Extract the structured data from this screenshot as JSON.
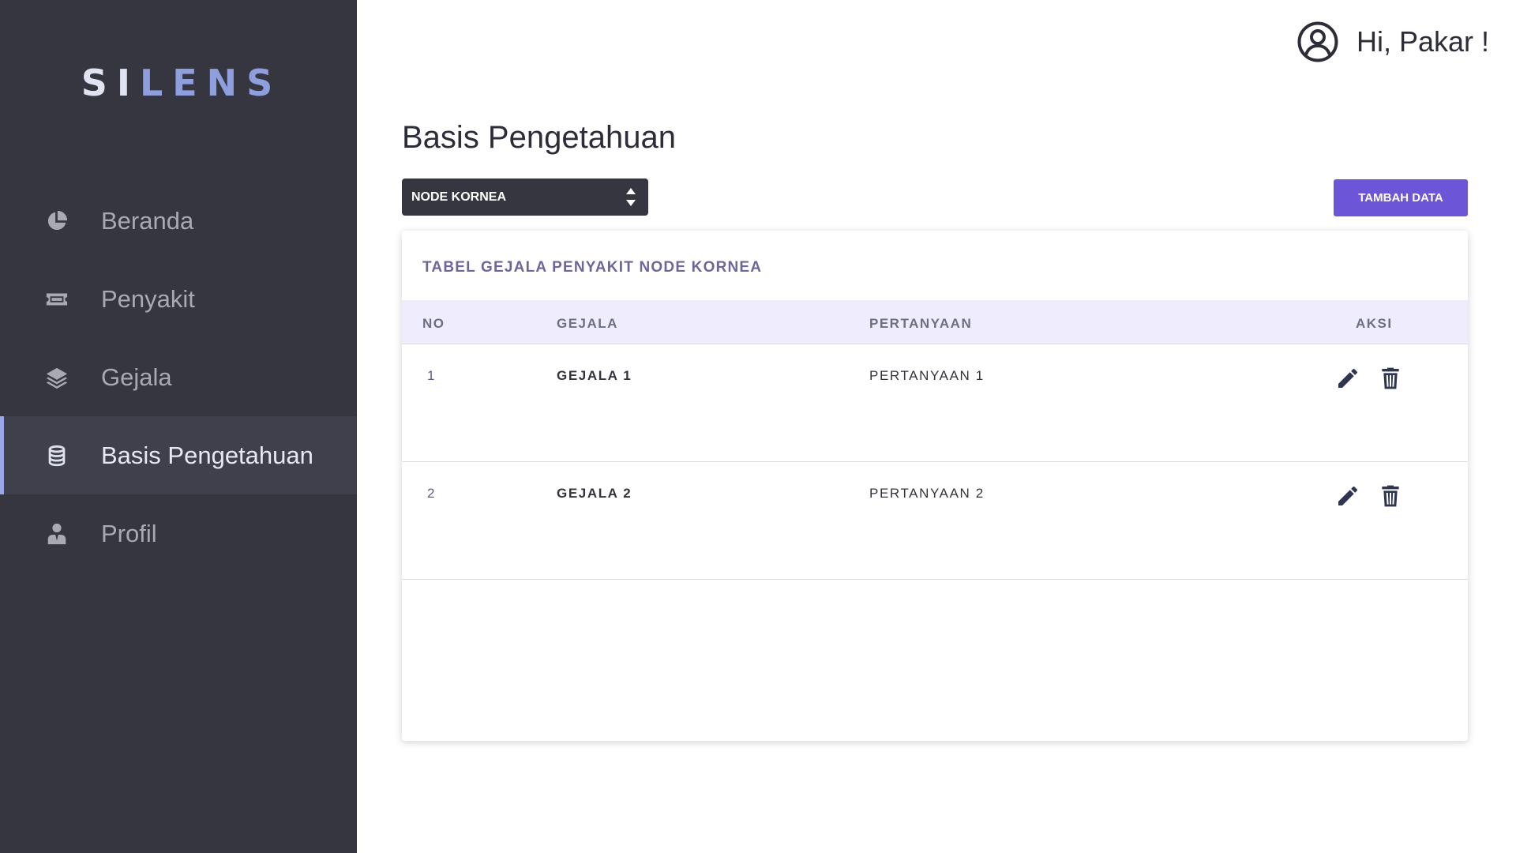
{
  "app": {
    "logo_part1": "SI",
    "logo_part2": "LENS"
  },
  "colors": {
    "sidebar_bg": "#363640",
    "accent": "#6c55d6",
    "logo_light": "#dfe3f2",
    "logo_blue": "#8f9fde"
  },
  "sidebar": {
    "items": [
      {
        "label": "Beranda",
        "icon": "pie-chart-icon",
        "active": false
      },
      {
        "label": "Penyakit",
        "icon": "ticket-icon",
        "active": false
      },
      {
        "label": "Gejala",
        "icon": "layers-icon",
        "active": false
      },
      {
        "label": "Basis Pengetahuan",
        "icon": "database-icon",
        "active": true
      },
      {
        "label": "Profil",
        "icon": "user-tie-icon",
        "active": false
      }
    ]
  },
  "header": {
    "greeting": "Hi, Pakar !",
    "user_icon": "user-circle-icon"
  },
  "main": {
    "title": "Basis Pengetahuan",
    "select": {
      "selected": "NODE KORNEA"
    },
    "add_button_label": "TAMBAH DATA",
    "table": {
      "title": "TABEL GEJALA PENYAKIT NODE KORNEA",
      "columns": [
        "NO",
        "GEJALA",
        "PERTANYAAN",
        "AKSI"
      ],
      "rows": [
        {
          "no": "1",
          "gejala": "GEJALA 1",
          "pertanyaan": "PERTANYAAN 1"
        },
        {
          "no": "2",
          "gejala": "GEJALA 2",
          "pertanyaan": "PERTANYAAN 2"
        }
      ]
    }
  }
}
